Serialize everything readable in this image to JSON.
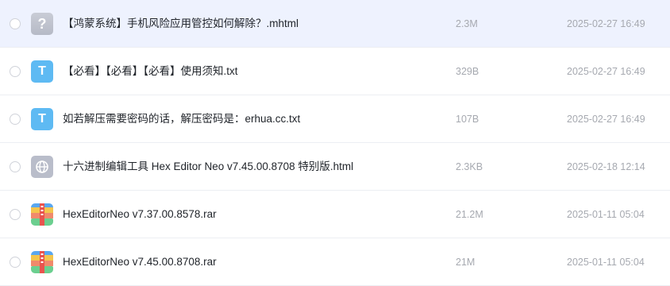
{
  "files": [
    {
      "name": "【鸿蒙系统】手机风险应用管控如何解除？.mhtml",
      "size": "2.3M",
      "date": "2025-02-27 16:49",
      "icon": "unknown-file-icon",
      "icon_glyph": "?",
      "selected": true
    },
    {
      "name": "【必看】【必看】【必看】使用须知.txt",
      "size": "329B",
      "date": "2025-02-27 16:49",
      "icon": "text-file-icon",
      "icon_glyph": "T",
      "selected": false
    },
    {
      "name": "如若解压需要密码的话，解压密码是：erhua.cc.txt",
      "size": "107B",
      "date": "2025-02-27 16:49",
      "icon": "text-file-icon",
      "icon_glyph": "T",
      "selected": false
    },
    {
      "name": "十六进制编辑工具 Hex Editor Neo v7.45.00.8708 特别版.html",
      "size": "2.3KB",
      "date": "2025-02-18 12:14",
      "icon": "web-file-icon",
      "icon_glyph": "",
      "selected": false
    },
    {
      "name": "HexEditorNeo v7.37.00.8578.rar",
      "size": "21.2M",
      "date": "2025-01-11 05:04",
      "icon": "archive-file-icon",
      "icon_glyph": "",
      "selected": false
    },
    {
      "name": "HexEditorNeo v7.45.00.8708.rar",
      "size": "21M",
      "date": "2025-01-11 05:04",
      "icon": "archive-file-icon",
      "icon_glyph": "",
      "selected": false
    }
  ],
  "colors": {
    "selected_row_bg": "#eef2fe",
    "row_divider": "#eceef3",
    "text_primary": "#1f2329",
    "text_secondary": "#a6a9b0",
    "text_icon": "#5ebaf3",
    "unknown_icon": "#c1c5d0",
    "web_icon": "#b9bdca"
  }
}
